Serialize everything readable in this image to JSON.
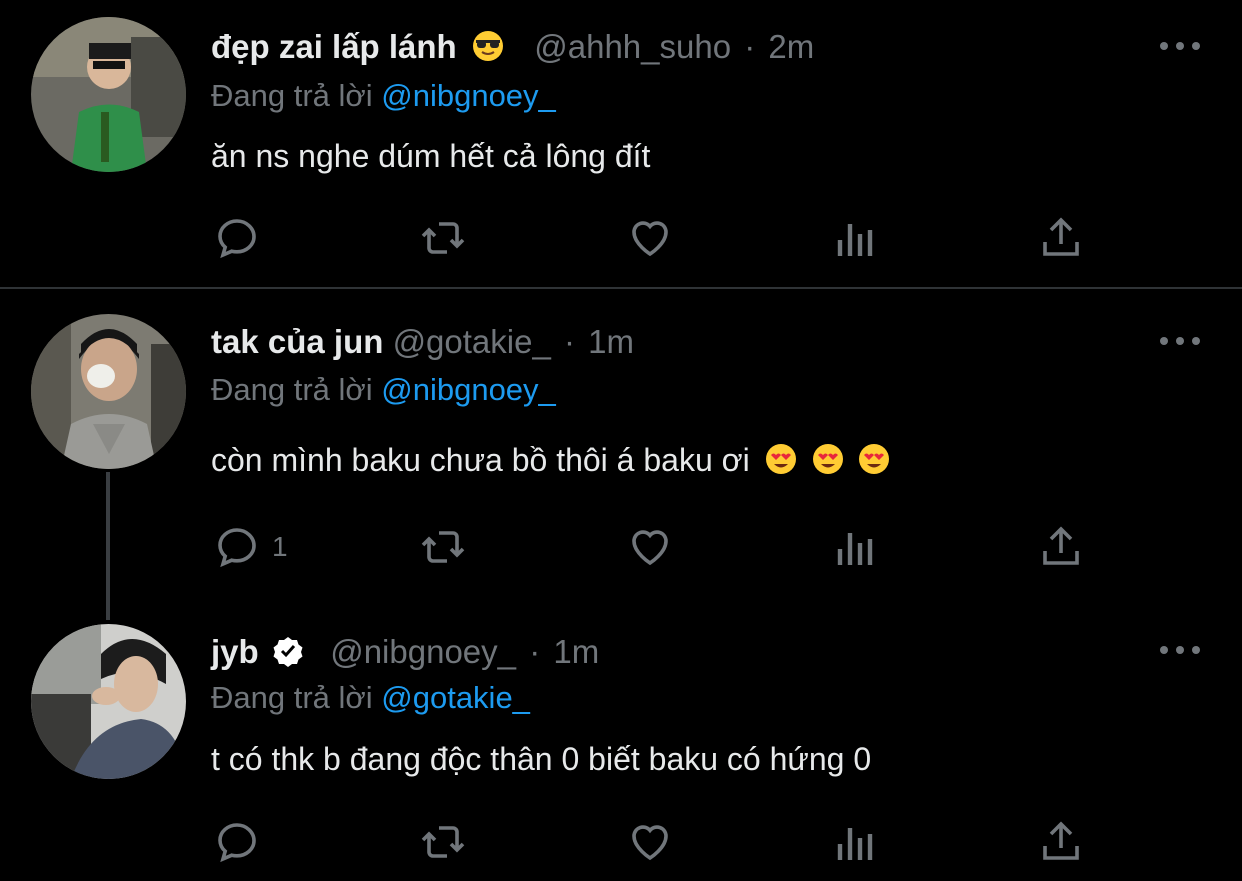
{
  "tweets": [
    {
      "name": "đẹp zai lấp lánh",
      "handle": "@ahhh_suho",
      "time": "2m",
      "replying_prefix": "Đang trả lời",
      "replying_to": "@nibgnoey_",
      "text": "ăn ns nghe dúm hết cả lông đít",
      "reply_count": ""
    },
    {
      "name": "tak của jun",
      "handle": "@gotakie_",
      "time": "1m",
      "replying_prefix": "Đang trả lời",
      "replying_to": "@nibgnoey_",
      "text": "còn mình baku chưa bồ thôi á baku ơi",
      "reply_count": "1"
    },
    {
      "name": "jyb",
      "handle": "@nibgnoey_",
      "time": "1m",
      "replying_prefix": "Đang trả lời",
      "replying_to": "@gotakie_",
      "text": "t có thk b đang độc thân 0 biết baku có hứng 0",
      "reply_count": ""
    }
  ],
  "separator": "·",
  "icons": {
    "reply": "reply-icon",
    "retweet": "retweet-icon",
    "like": "heart-icon",
    "views": "views-icon",
    "share": "share-icon",
    "more": "more-icon",
    "verified": "verified-icon"
  },
  "colors": {
    "background": "#000000",
    "text": "#e7e9ea",
    "muted": "#71767b",
    "link": "#1d9bf0"
  }
}
